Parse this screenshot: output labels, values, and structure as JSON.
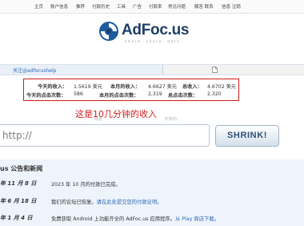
{
  "nav": {
    "items": [
      "主页",
      "账户信息",
      "推荐",
      "付款历史",
      "工具",
      "广告",
      "付款率",
      "常见问题",
      "解答 联系",
      "信息 注销"
    ]
  },
  "logo": {
    "name": "AdFoc.us",
    "tagline": "share. share. earn."
  },
  "tabbar": {
    "help_link": "关注@adfocushelp"
  },
  "stats": {
    "today_income_label": "今天的收入：",
    "today_income_value": "1.5619 美元",
    "month_income_label": "本月的收入：",
    "month_income_value": "4.6627 美元",
    "total_income_label": "总收入：",
    "total_income_value": "4.6702 美元",
    "today_clicks_label": "今天的点击次数：",
    "today_clicks_value": "586",
    "month_clicks_label": "本月的点击次数：",
    "month_clicks_value": "2,319",
    "total_clicks_label": "总点击次数：",
    "total_clicks_value": "2,320"
  },
  "annotation": "这是10几分钟的收入",
  "faint": {
    "left": "或者",
    "right": "所有的…"
  },
  "shortener": {
    "input_value": "http://",
    "button_label": "SHRINK!"
  },
  "notices": {
    "title": "us 公告和新闻",
    "items": [
      {
        "date": "年 11 月 8 日",
        "text": "2023 年 10 月的付款已完成。",
        "link": ""
      },
      {
        "date": "年 6 月 18 日",
        "text": "我们的论坛已恢复。",
        "link": "请在此处提交您的付款证明。"
      },
      {
        "date": "年 1 月 4 日",
        "text": "免费获取 Android 上功能齐全的 AdFoc.us 应用程序。",
        "link": "从 Play 商店下载。"
      }
    ]
  },
  "colors": {
    "highlight_border": "#cc1e1e",
    "annotation": "#d11f1f",
    "link": "#2c68b5",
    "brand": "#1d3f66"
  }
}
